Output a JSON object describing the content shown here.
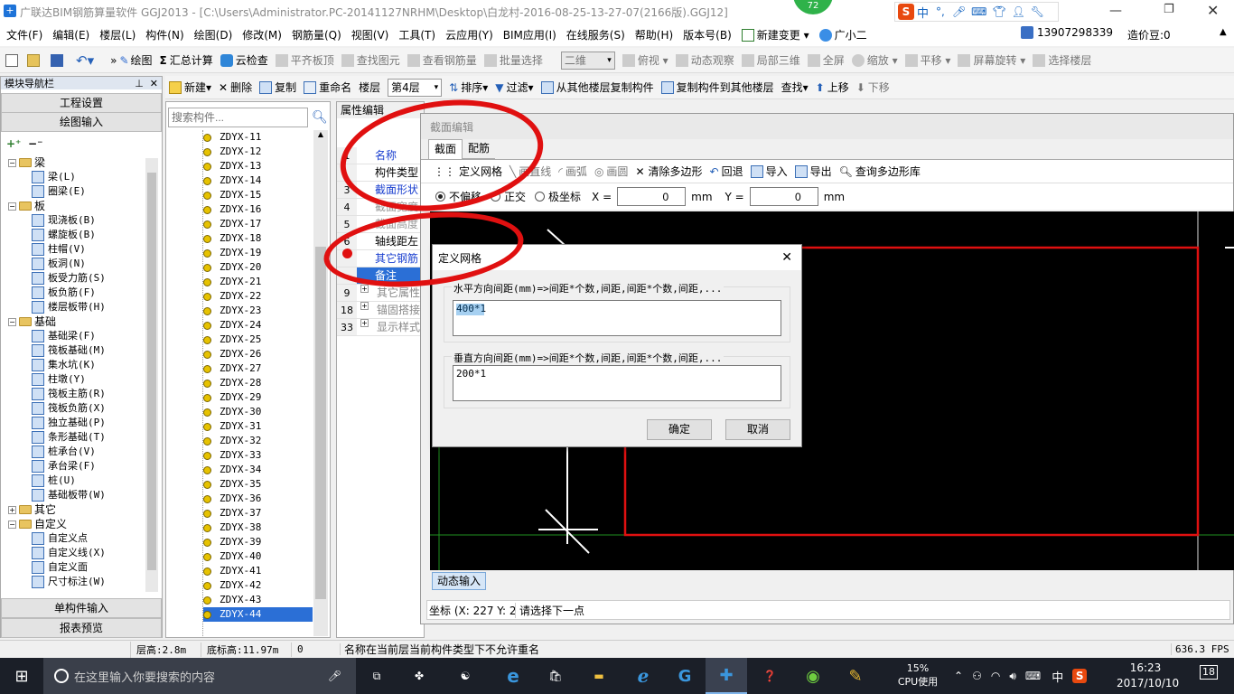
{
  "title": "广联达BIM钢筋算量软件 GGJ2013 - [C:\\Users\\Administrator.PC-20141127NRHM\\Desktop\\白龙村-2016-08-25-13-27-07(2166版).GGJ12]",
  "badge": "72",
  "ime": {
    "lang": "中"
  },
  "menu": [
    "文件(F)",
    "编辑(E)",
    "楼层(L)",
    "构件(N)",
    "绘图(D)",
    "修改(M)",
    "钢筋量(Q)",
    "视图(V)",
    "工具(T)",
    "云应用(Y)",
    "BIM应用(I)",
    "在线服务(S)",
    "帮助(H)",
    "版本号(B)",
    "新建变更",
    "广小二"
  ],
  "account": {
    "phone": "13907298339",
    "points": "造价豆:0"
  },
  "toolbar1": {
    "draw": "绘图",
    "sum": "汇总计算",
    "cloud": "云检查",
    "flat": "平齐板顶",
    "find": "查找图元",
    "view": "查看钢筋量",
    "batch": "批量选择",
    "view2d": "二维",
    "top": "俯视",
    "dyn": "动态观察",
    "local3d": "局部三维",
    "fullscreen": "全屏",
    "zoom": "缩放",
    "pan": "平移",
    "rotate": "屏幕旋转",
    "selfloor": "选择楼层"
  },
  "toolbar2": {
    "new": "新建",
    "delete": "删除",
    "copy": "复制",
    "rename": "重命名",
    "floor_label": "楼层",
    "floor": "第4层",
    "sort": "排序",
    "filter": "过滤",
    "copy_from": "从其他楼层复制构件",
    "copy_to": "复制构件到其他楼层",
    "search": "查找",
    "up": "上移",
    "down": "下移"
  },
  "nav": {
    "title": "模块导航栏",
    "eng": "工程设置",
    "draw": "绘图输入",
    "single": "单构件输入",
    "report": "报表预览",
    "tree": [
      {
        "t": "梁",
        "lvl": 0,
        "folder": true
      },
      {
        "t": "梁(L)",
        "lvl": 1
      },
      {
        "t": "圈梁(E)",
        "lvl": 1
      },
      {
        "t": "板",
        "lvl": 0,
        "folder": true
      },
      {
        "t": "现浇板(B)",
        "lvl": 1
      },
      {
        "t": "螺旋板(B)",
        "lvl": 1
      },
      {
        "t": "柱帽(V)",
        "lvl": 1
      },
      {
        "t": "板洞(N)",
        "lvl": 1
      },
      {
        "t": "板受力筋(S)",
        "lvl": 1
      },
      {
        "t": "板负筋(F)",
        "lvl": 1
      },
      {
        "t": "楼层板带(H)",
        "lvl": 1
      },
      {
        "t": "基础",
        "lvl": 0,
        "folder": true
      },
      {
        "t": "基础梁(F)",
        "lvl": 1
      },
      {
        "t": "筏板基础(M)",
        "lvl": 1
      },
      {
        "t": "集水坑(K)",
        "lvl": 1
      },
      {
        "t": "柱墩(Y)",
        "lvl": 1
      },
      {
        "t": "筏板主筋(R)",
        "lvl": 1
      },
      {
        "t": "筏板负筋(X)",
        "lvl": 1
      },
      {
        "t": "独立基础(P)",
        "lvl": 1
      },
      {
        "t": "条形基础(T)",
        "lvl": 1
      },
      {
        "t": "桩承台(V)",
        "lvl": 1
      },
      {
        "t": "承台梁(F)",
        "lvl": 1
      },
      {
        "t": "桩(U)",
        "lvl": 1
      },
      {
        "t": "基础板带(W)",
        "lvl": 1
      },
      {
        "t": "其它",
        "lvl": 0,
        "folder": true,
        "collapsed": true
      },
      {
        "t": "自定义",
        "lvl": 0,
        "folder": true
      },
      {
        "t": "自定义点",
        "lvl": 1
      },
      {
        "t": "自定义线(X)",
        "lvl": 1
      },
      {
        "t": "自定义面",
        "lvl": 1
      },
      {
        "t": "尺寸标注(W)",
        "lvl": 1
      }
    ]
  },
  "components": {
    "search_placeholder": "搜索构件...",
    "items": [
      "ZDYX-11",
      "ZDYX-12",
      "ZDYX-13",
      "ZDYX-14",
      "ZDYX-15",
      "ZDYX-16",
      "ZDYX-17",
      "ZDYX-18",
      "ZDYX-19",
      "ZDYX-20",
      "ZDYX-21",
      "ZDYX-22",
      "ZDYX-23",
      "ZDYX-24",
      "ZDYX-25",
      "ZDYX-26",
      "ZDYX-27",
      "ZDYX-28",
      "ZDYX-29",
      "ZDYX-30",
      "ZDYX-31",
      "ZDYX-32",
      "ZDYX-33",
      "ZDYX-34",
      "ZDYX-35",
      "ZDYX-36",
      "ZDYX-37",
      "ZDYX-38",
      "ZDYX-39",
      "ZDYX-40",
      "ZDYX-41",
      "ZDYX-42",
      "ZDYX-43",
      "ZDYX-44"
    ]
  },
  "props": {
    "header": "属性编辑",
    "rows": [
      {
        "n": "1",
        "t": "名称"
      },
      {
        "n": "",
        "t": "构件类型"
      },
      {
        "n": "3",
        "t": "截面形状"
      },
      {
        "n": "4",
        "t": "截面宽度"
      },
      {
        "n": "5",
        "t": "截面高度"
      },
      {
        "n": "6",
        "t": "轴线距左"
      },
      {
        "n": "",
        "t": "其它钢筋"
      },
      {
        "n": "",
        "t": "备注"
      },
      {
        "n": "9",
        "t": "其它属性"
      },
      {
        "n": "18",
        "t": "锚固搭接"
      },
      {
        "n": "33",
        "t": "显示样式"
      }
    ]
  },
  "section_editor": {
    "title": "截面编辑",
    "tabs": [
      "截面",
      "配筋"
    ],
    "tools": {
      "grid": "定义网格",
      "line": "画直线",
      "arc": "画弧",
      "circle": "画圆",
      "clear": "清除多边形",
      "undo": "回退",
      "import": "导入",
      "export": "导出",
      "query": "查询多边形库"
    },
    "modes": [
      "不偏移",
      "正交",
      "极坐标"
    ],
    "x_label": "X =",
    "x_value": "0",
    "y_label": "Y =",
    "y_value": "0",
    "unit": "mm",
    "dynamic": "动态输入",
    "coord": "坐标 (X: 227 Y: 219",
    "hint": "请选择下一点"
  },
  "grid_dialog": {
    "title": "定义网格",
    "h_label": "水平方向间距(mm)=>间距*个数,间距,间距*个数,间距,...",
    "h_value": "400*1",
    "v_label": "垂直方向间距(mm)=>间距*个数,间距,间距*个数,间距,...",
    "v_value": "200*1",
    "ok": "确定",
    "cancel": "取消"
  },
  "status": {
    "floor_h": "层高:2.8m",
    "base_h": "底标高:11.97m",
    "zero": "0",
    "msg": "名称在当前层当前构件类型下不允许重名",
    "fps": "636.3 FPS"
  },
  "taskbar": {
    "search": "在这里输入你要搜索的内容",
    "cpu_pct": "15%",
    "cpu_label": "CPU使用",
    "lang": "中",
    "time": "16:23",
    "date": "2017/10/10",
    "notif": "18"
  },
  "colors": {
    "accent": "#0078d7",
    "canvas": "#000000",
    "selection": "#2b6fd6",
    "ellipse": "#e01010"
  }
}
